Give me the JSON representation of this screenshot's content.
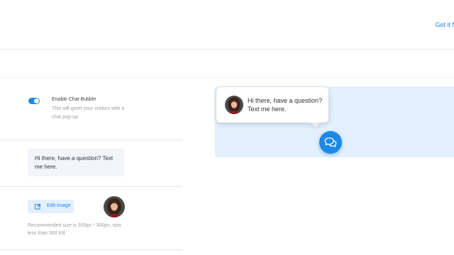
{
  "header": {
    "get_it_link": "Get it f"
  },
  "chat_settings": {
    "toggle_label": "Enable Chat Bubble",
    "toggle_description": "This will greet your visitors with a chat pop-up",
    "enabled": true,
    "greeting_message": "Hi there, have a question? Text me here.",
    "edit_image_label": "Edit Image",
    "image_size_note": "Recommended size is 300px * 300px, size less than 300 KB"
  },
  "preview": {
    "bubble_message": "Hi there, have a question? Text me here."
  },
  "colors": {
    "accent": "#1e88e5",
    "preview_background": "#e3f0fd",
    "edit_button_background": "#e3f0fc"
  },
  "icons": {
    "edit": "edit-icon",
    "chat": "chat-bubbles-icon"
  }
}
